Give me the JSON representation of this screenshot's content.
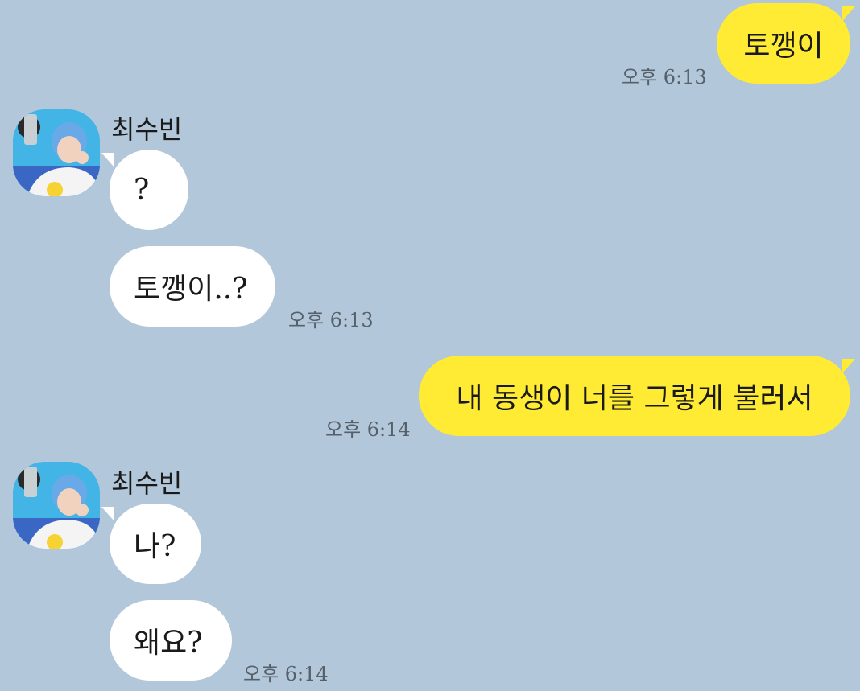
{
  "chat": {
    "contact_name": "최수빈",
    "messages": [
      {
        "sender": "me",
        "text": "토깽이",
        "time": "오후 6:13"
      },
      {
        "sender": "other",
        "text": "?",
        "time": ""
      },
      {
        "sender": "other",
        "text": "토깽이..?",
        "time": "오후 6:13"
      },
      {
        "sender": "me",
        "text": "내 동생이 너를 그렇게 불러서",
        "time": "오후 6:14"
      },
      {
        "sender": "other",
        "text": "나?",
        "time": ""
      },
      {
        "sender": "other",
        "text": "왜요?",
        "time": "오후 6:14"
      }
    ]
  },
  "colors": {
    "background": "#b2c7d9",
    "my_bubble": "#ffeb33",
    "their_bubble": "#ffffff"
  },
  "icons": {
    "avatar": "profile-photo-avatar"
  }
}
